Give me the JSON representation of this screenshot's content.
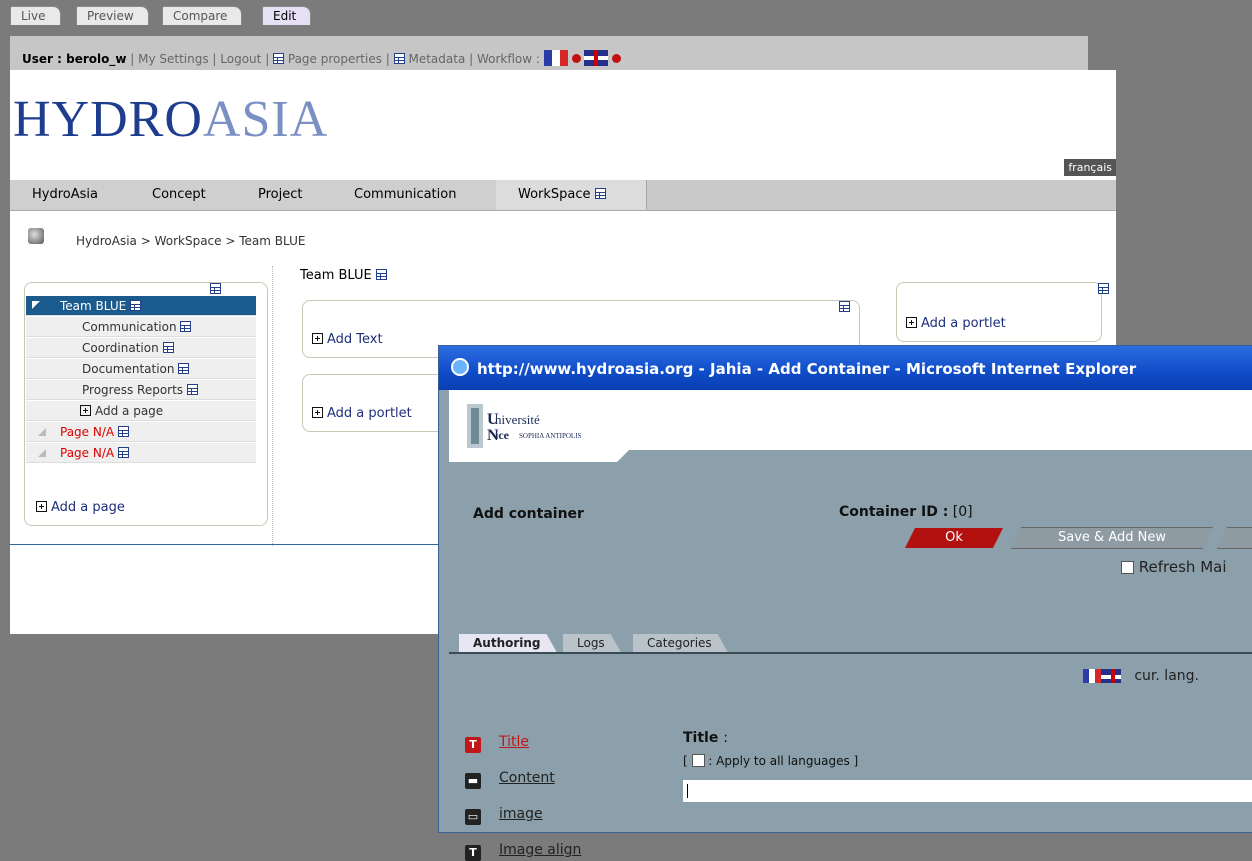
{
  "mode_tabs": [
    "Live",
    "Preview",
    "Compare",
    "Edit"
  ],
  "admin_bar": {
    "user_label": "User : berolo_w",
    "my_settings": "My Settings",
    "logout": "Logout",
    "page_properties": "Page properties",
    "metadata": "Metadata",
    "workflow": "Workflow :"
  },
  "site": {
    "logo_part1": "HYDRO",
    "logo_part2": "ASIA",
    "language_switch": "français",
    "nav": [
      "HydroAsia",
      "Concept",
      "Project",
      "Communication",
      "WorkSpace"
    ],
    "breadcrumb": "HydroAsia  >  WorkSpace  >  Team BLUE"
  },
  "tree": {
    "selected": "Team BLUE",
    "children": [
      "Communication",
      "Coordination",
      "Documentation",
      "Progress Reports"
    ],
    "add_page_inner": "Add a page",
    "na_pages": [
      "Page N/A",
      "Page N/A"
    ],
    "add_page": "Add a page"
  },
  "main": {
    "title": "Team BLUE",
    "add_text": "Add Text",
    "add_portlet": "Add a portlet",
    "right_add_portlet": "Add a portlet"
  },
  "popup": {
    "title": "http://www.hydroasia.org - Jahia - Add Container - Microsoft Internet Explorer",
    "university_line1": "niversité",
    "university_line2": "ice",
    "university_sub": "SOPHIA ANTIPOLIS",
    "header": "Add container",
    "container_id_label": "Container ID :",
    "container_id_value": "[0]",
    "ok_button": "Ok",
    "save_add_new_button": "Save & Add New",
    "refresh_label": "Refresh Mai",
    "tabs": [
      "Authoring",
      "Logs",
      "Categories"
    ],
    "cur_lang": "cur. lang.",
    "fields": [
      {
        "icon": "T",
        "label": "Title"
      },
      {
        "icon": "▬",
        "label": "Content"
      },
      {
        "icon": "▭",
        "label": "image"
      },
      {
        "icon": "T",
        "label": "Image align"
      }
    ],
    "field_title": "Title",
    "field_colon": ":",
    "apply_all": ": Apply to all languages"
  }
}
